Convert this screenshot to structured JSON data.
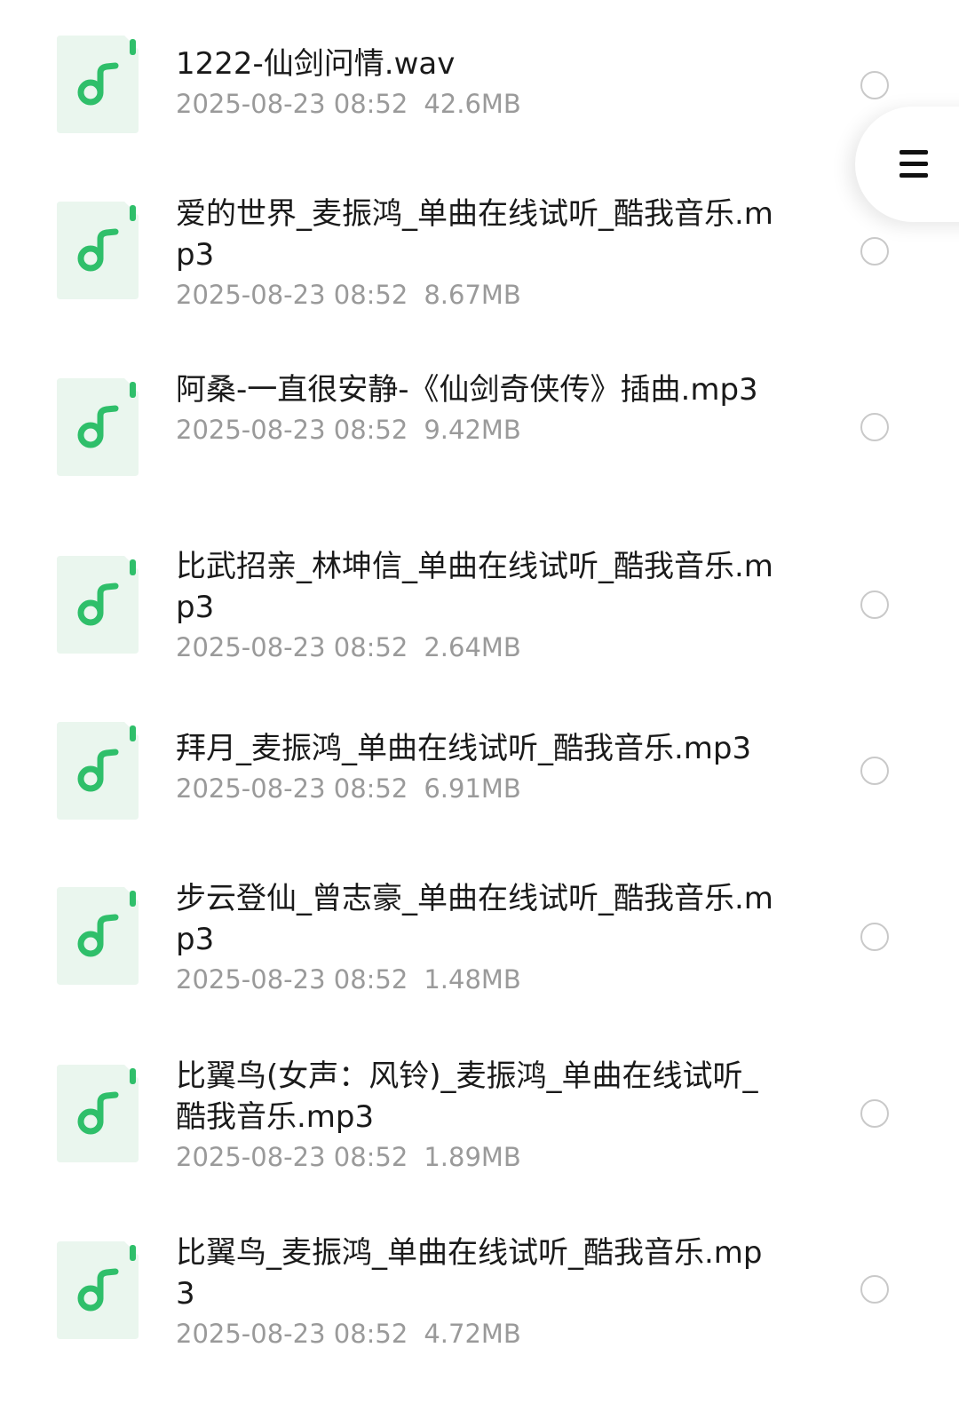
{
  "colors": {
    "icon_bg": "#eaf6ee",
    "icon_accent": "#2fbf6a",
    "title_text": "#1a1a1a",
    "meta_text": "#9a9a9a",
    "radio_border": "#c9c9c9"
  },
  "icons": {
    "file": "music-note-icon",
    "menu": "menu-icon",
    "select": "radio-unchecked-icon"
  },
  "files": [
    {
      "name": "1222-仙剑问情.wav",
      "date": "2025-08-23 08:52",
      "size": "42.6MB"
    },
    {
      "name": "爱的世界_麦振鸿_单曲在线试听_酷我音乐.mp3",
      "date": "2025-08-23 08:52",
      "size": "8.67MB"
    },
    {
      "name": "阿桑-一直很安静-《仙剑奇侠传》插曲.mp3",
      "date": "2025-08-23 08:52",
      "size": "9.42MB"
    },
    {
      "name": "比武招亲_林坤信_单曲在线试听_酷我音乐.mp3",
      "date": "2025-08-23 08:52",
      "size": "2.64MB"
    },
    {
      "name": "拜月_麦振鸿_单曲在线试听_酷我音乐.mp3",
      "date": "2025-08-23 08:52",
      "size": "6.91MB"
    },
    {
      "name": "步云登仙_曾志豪_单曲在线试听_酷我音乐.mp3",
      "date": "2025-08-23 08:52",
      "size": "1.48MB"
    },
    {
      "name": "比翼鸟(女声：风铃)_麦振鸿_单曲在线试听_酷我音乐.mp3",
      "date": "2025-08-23 08:52",
      "size": "1.89MB"
    },
    {
      "name": "比翼鸟_麦振鸿_单曲在线试听_酷我音乐.mp3",
      "date": "2025-08-23 08:52",
      "size": "4.72MB"
    }
  ]
}
